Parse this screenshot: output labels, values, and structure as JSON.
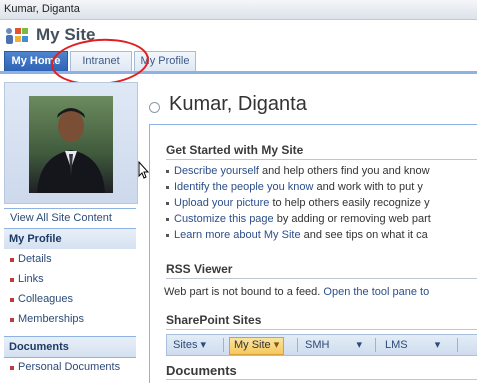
{
  "window": {
    "title": "Kumar, Diganta"
  },
  "site": {
    "title": "My Site"
  },
  "tabs": [
    {
      "label": "My Home",
      "active": true
    },
    {
      "label": "Intranet",
      "active": false
    },
    {
      "label": "My Profile",
      "active": false
    }
  ],
  "leftnav": {
    "view_all": "View All Site Content",
    "profile_heading": "My Profile",
    "profile_items": [
      "Details",
      "Links",
      "Colleagues",
      "Memberships"
    ],
    "documents_heading": "Documents",
    "documents_items": [
      "Personal Documents"
    ]
  },
  "page": {
    "title": "Kumar, Diganta"
  },
  "get_started": {
    "title": "Get Started with My Site",
    "items": [
      {
        "link": "Describe yourself",
        "rest": " and help others find you and know"
      },
      {
        "link": "Identify the people you know",
        "rest": " and work with to put y"
      },
      {
        "link": "Upload your picture",
        "rest": " to help others easily recognize y"
      },
      {
        "link": "Customize this page",
        "rest": " by adding or removing web part"
      },
      {
        "link": "Learn more about My Site",
        "rest": " and see tips on what it ca"
      }
    ]
  },
  "rss": {
    "title": "RSS Viewer",
    "text": "Web part is not bound to a feed. ",
    "link": "Open the tool pane to"
  },
  "sharepoint_sites": {
    "title": "SharePoint Sites",
    "items": [
      "Sites",
      "My Site",
      "SMH",
      "LMS"
    ]
  },
  "documents": {
    "title": "Documents"
  },
  "colors": {
    "accent": "#2d62b5",
    "highlight_circle": "#e02020",
    "link": "#2c4f8a"
  }
}
